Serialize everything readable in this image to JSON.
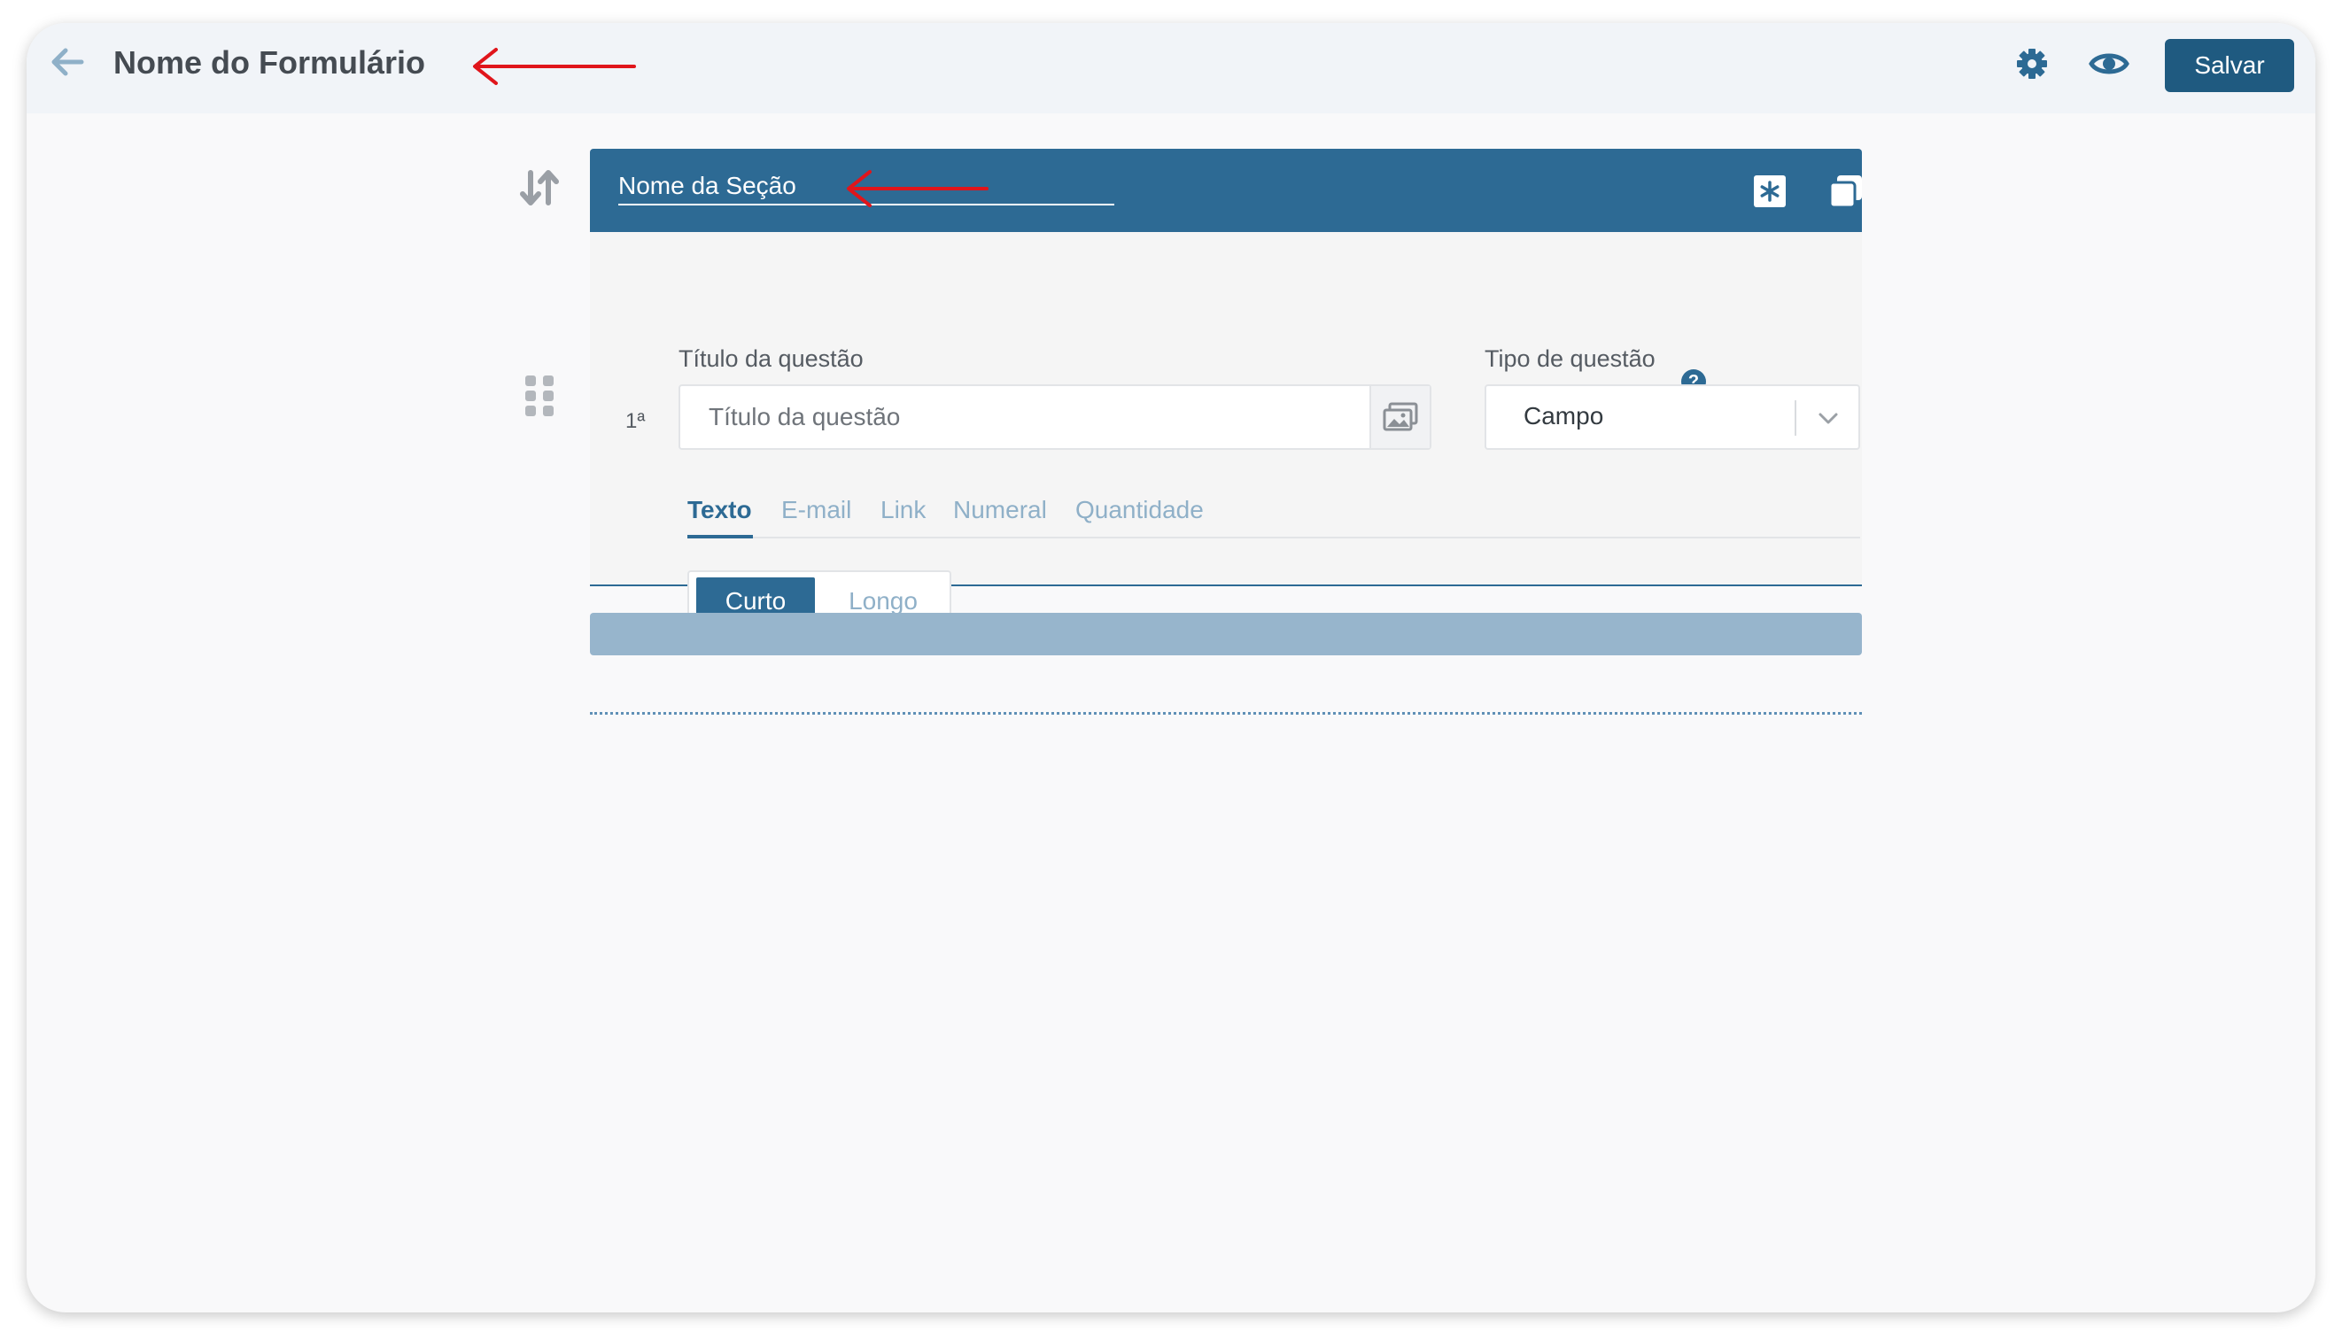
{
  "header": {
    "title": "Nome do Formulário",
    "save_label": "Salvar",
    "icons": [
      "back-arrow-icon",
      "gear-icon",
      "eye-icon"
    ]
  },
  "section": {
    "name": "Nome da Seção",
    "header_icons": [
      "asterisk-icon",
      "copy-icon"
    ]
  },
  "question": {
    "number": "1ª",
    "title_label": "Título da questão",
    "title_placeholder": "Título da questão",
    "type_label": "Tipo de questão",
    "type_value": "Campo",
    "tabs": [
      "Texto",
      "E-mail",
      "Link",
      "Numeral",
      "Quantidade"
    ],
    "active_tab": "Texto",
    "length_options": [
      "Curto",
      "Longo"
    ],
    "selected_length": "Curto"
  },
  "sidebar_icons": [
    "sort-icon",
    "drag-handle-icon"
  ],
  "colors": {
    "primary": "#2d6a94",
    "save_button": "#1f5a80",
    "annotation": "#e0151b",
    "add_bar": "#97b5cc"
  }
}
